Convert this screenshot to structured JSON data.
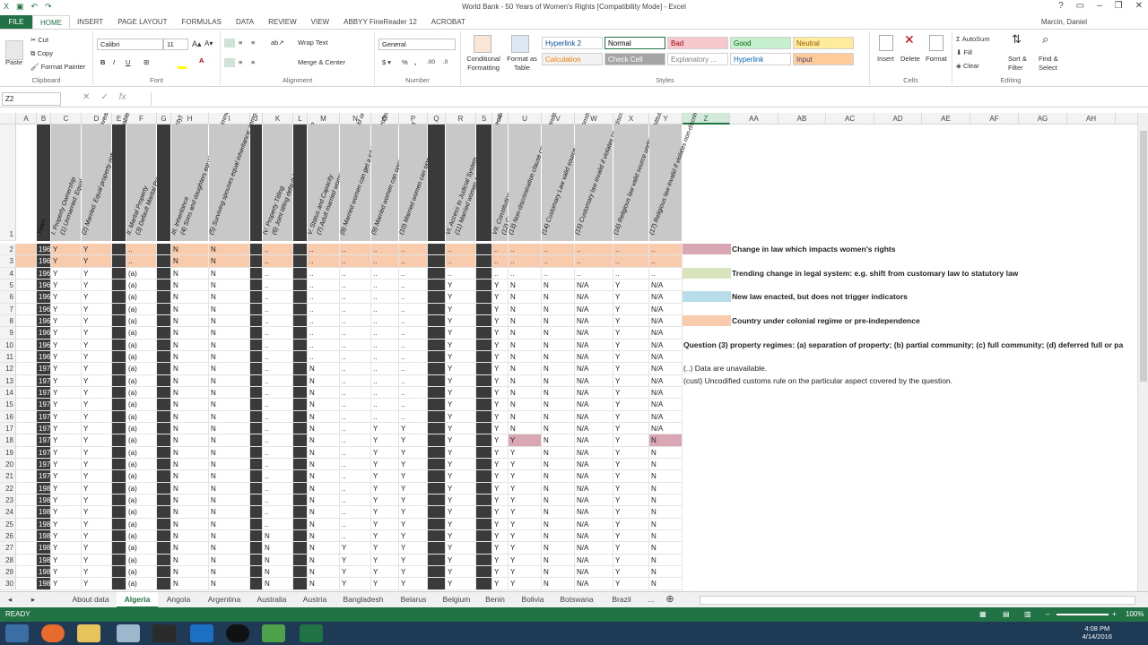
{
  "window": {
    "title": "World Bank - 50 Years of Women's Rights  [Compatibility Mode] - Excel"
  },
  "ribbon_tabs": [
    "FILE",
    "HOME",
    "INSERT",
    "PAGE LAYOUT",
    "FORMULAS",
    "DATA",
    "REVIEW",
    "VIEW",
    "ABBYY FineReader 12",
    "ACROBAT"
  ],
  "user": "Marcin, Daniel",
  "ribbon": {
    "clipboard": {
      "paste": "Paste",
      "cut": "Cut",
      "copy": "Copy",
      "format_painter": "Format Painter",
      "group": "Clipboard"
    },
    "font": {
      "name": "Calibri",
      "size": "11",
      "group": "Font"
    },
    "alignment": {
      "wrap": "Wrap Text",
      "merge": "Merge & Center",
      "group": "Alignment"
    },
    "number": {
      "format": "General",
      "group": "Number"
    },
    "styles": {
      "cond": "Conditional Formatting",
      "fmt_table": "Format as Table",
      "group": "Styles",
      "cells": [
        {
          "label": "Hyperlink 2",
          "bg": "#ffffff",
          "fg": "#0b4fa3"
        },
        {
          "label": "Normal",
          "bg": "#ffffff",
          "fg": "#000000"
        },
        {
          "label": "Bad",
          "bg": "#f7c7ce",
          "fg": "#9c0006"
        },
        {
          "label": "Good",
          "bg": "#c6efce",
          "fg": "#006100"
        },
        {
          "label": "Neutral",
          "bg": "#ffeb9c",
          "fg": "#9c5700"
        },
        {
          "label": "Calculation",
          "bg": "#f2f2f2",
          "fg": "#fa7d00"
        },
        {
          "label": "Check Cell",
          "bg": "#a5a5a5",
          "fg": "#ffffff"
        },
        {
          "label": "Explanatory ...",
          "bg": "#ffffff",
          "fg": "#7f7f7f"
        },
        {
          "label": "Hyperlink",
          "bg": "#ffffff",
          "fg": "#0563c1"
        },
        {
          "label": "Input",
          "bg": "#ffcc99",
          "fg": "#3f3f76"
        }
      ]
    },
    "cells": {
      "insert": "Insert",
      "delete": "Delete",
      "format": "Format",
      "group": "Cells"
    },
    "editing": {
      "autosum": "AutoSum",
      "fill": "Fill",
      "clear": "Clear",
      "sort": "Sort & Filter",
      "find": "Find & Select",
      "group": "Editing"
    }
  },
  "formula_bar": {
    "name_box": "Z2",
    "formula": ""
  },
  "columns": [
    "A",
    "B",
    "C",
    "D",
    "E",
    "F",
    "G",
    "H",
    "I",
    "J",
    "K",
    "L",
    "M",
    "N",
    "O",
    "P",
    "Q",
    "R",
    "S",
    "T",
    "U",
    "V",
    "W",
    "X",
    "Y",
    "Z",
    "AA",
    "AB",
    "AC",
    "AD",
    "AE",
    "AF",
    "AG",
    "AH"
  ],
  "headers": [
    "Years",
    "I. Property Ownership",
    "(1) Unmarried: Equal property rights, immoveables",
    "(2) Married: Equal property rights, immoveables",
    "II. Marital Property",
    "(3) Default Marital Property Regime (majority)",
    "III. Inheritance",
    "(4) Sons and daughters equal inheritance immoveable property (majority)",
    "(5) Surviving spouses equal inheritance: immoveable property (majority)",
    "IV. Property Titling",
    "(6) Joint titling default for married couples?",
    "V. Status and Capacity",
    "(7) Adult married women head of household or head of family",
    "(8) Married women can get a job/pursue profession",
    "(9) Married women can open bank account",
    "(10) Married women can sign contract",
    "VI. Access to Judicial System",
    "(11) Married women can initiate legal proceedings without husband's permission",
    "VII. Constitutions",
    "(12) Guaranteed Equality",
    "(13) Non-discrimination clause covering gender/sex",
    "(14) Customary Law valid source under Constitution?",
    "(15) Customary law invalid if violates non-discrimination clause",
    "(16) Religious law valid source under Constitution?",
    "(17) Religious law invalid if violates non-discrimination clause"
  ],
  "rows": [
    {
      "n": "2",
      "year": "1960",
      "c": "Y",
      "d": "Y",
      "f": "..",
      "h": "N",
      "i": "N",
      "k": "..",
      "m": "..",
      "n2": "..",
      "o": "..",
      "p": "..",
      "r": "..",
      "t": "..",
      "u": "..",
      "v": "..",
      "w": "..",
      "x": "..",
      "y": "..",
      "row_style": "colonial"
    },
    {
      "n": "3",
      "year": "1961",
      "c": "Y",
      "d": "Y",
      "f": "..",
      "h": "N",
      "i": "N",
      "k": "..",
      "m": "..",
      "n2": "..",
      "o": "..",
      "p": "..",
      "r": "..",
      "t": "..",
      "u": "..",
      "v": "..",
      "w": "..",
      "x": "..",
      "y": "..",
      "row_style": "colonial"
    },
    {
      "n": "4",
      "year": "1962",
      "c": "Y",
      "d": "Y",
      "f": "(a)",
      "h": "N",
      "i": "N",
      "k": "..",
      "m": "..",
      "n2": "..",
      "o": "..",
      "p": "..",
      "r": "..",
      "t": "..",
      "u": "..",
      "v": "..",
      "w": "..",
      "x": "..",
      "y": ".."
    },
    {
      "n": "5",
      "year": "1963",
      "c": "Y",
      "d": "Y",
      "f": "(a)",
      "h": "N",
      "i": "N",
      "k": "..",
      "m": "..",
      "n2": "..",
      "o": "..",
      "p": "..",
      "r": "Y",
      "t": "Y",
      "u": "N",
      "v": "N",
      "w": "N/A",
      "x": "Y",
      "y": "N/A"
    },
    {
      "n": "6",
      "year": "1964",
      "c": "Y",
      "d": "Y",
      "f": "(a)",
      "h": "N",
      "i": "N",
      "k": "..",
      "m": "..",
      "n2": "..",
      "o": "..",
      "p": "..",
      "r": "Y",
      "t": "Y",
      "u": "N",
      "v": "N",
      "w": "N/A",
      "x": "Y",
      "y": "N/A"
    },
    {
      "n": "7",
      "year": "1965",
      "c": "Y",
      "d": "Y",
      "f": "(a)",
      "h": "N",
      "i": "N",
      "k": "..",
      "m": "..",
      "n2": "..",
      "o": "..",
      "p": "..",
      "r": "Y",
      "t": "Y",
      "u": "N",
      "v": "N",
      "w": "N/A",
      "x": "Y",
      "y": "N/A"
    },
    {
      "n": "8",
      "year": "1966",
      "c": "Y",
      "d": "Y",
      "f": "(a)",
      "h": "N",
      "i": "N",
      "k": "..",
      "m": "..",
      "n2": "..",
      "o": "..",
      "p": "..",
      "r": "Y",
      "t": "Y",
      "u": "N",
      "v": "N",
      "w": "N/A",
      "x": "Y",
      "y": "N/A"
    },
    {
      "n": "9",
      "year": "1967",
      "c": "Y",
      "d": "Y",
      "f": "(a)",
      "h": "N",
      "i": "N",
      "k": "..",
      "m": "..",
      "n2": "..",
      "o": "..",
      "p": "..",
      "r": "Y",
      "t": "Y",
      "u": "N",
      "v": "N",
      "w": "N/A",
      "x": "Y",
      "y": "N/A"
    },
    {
      "n": "10",
      "year": "1968",
      "c": "Y",
      "d": "Y",
      "f": "(a)",
      "h": "N",
      "i": "N",
      "k": "..",
      "m": "..",
      "n2": "..",
      "o": "..",
      "p": "..",
      "r": "Y",
      "t": "Y",
      "u": "N",
      "v": "N",
      "w": "N/A",
      "x": "Y",
      "y": "N/A"
    },
    {
      "n": "11",
      "year": "1969",
      "c": "Y",
      "d": "Y",
      "f": "(a)",
      "h": "N",
      "i": "N",
      "k": "..",
      "m": "..",
      "n2": "..",
      "o": "..",
      "p": "..",
      "r": "Y",
      "t": "Y",
      "u": "N",
      "v": "N",
      "w": "N/A",
      "x": "Y",
      "y": "N/A"
    },
    {
      "n": "12",
      "year": "1970",
      "c": "Y",
      "d": "Y",
      "f": "(a)",
      "h": "N",
      "i": "N",
      "k": "..",
      "m": "N",
      "n2": "..",
      "o": "..",
      "p": "..",
      "r": "Y",
      "t": "Y",
      "u": "N",
      "v": "N",
      "w": "N/A",
      "x": "Y",
      "y": "N/A"
    },
    {
      "n": "13",
      "year": "1971",
      "c": "Y",
      "d": "Y",
      "f": "(a)",
      "h": "N",
      "i": "N",
      "k": "..",
      "m": "N",
      "n2": "..",
      "o": "..",
      "p": "..",
      "r": "Y",
      "t": "Y",
      "u": "N",
      "v": "N",
      "w": "N/A",
      "x": "Y",
      "y": "N/A"
    },
    {
      "n": "14",
      "year": "1972",
      "c": "Y",
      "d": "Y",
      "f": "(a)",
      "h": "N",
      "i": "N",
      "k": "..",
      "m": "N",
      "n2": "..",
      "o": "..",
      "p": "..",
      "r": "Y",
      "t": "Y",
      "u": "N",
      "v": "N",
      "w": "N/A",
      "x": "Y",
      "y": "N/A"
    },
    {
      "n": "15",
      "year": "1973",
      "c": "Y",
      "d": "Y",
      "f": "(a)",
      "h": "N",
      "i": "N",
      "k": "..",
      "m": "N",
      "n2": "..",
      "o": "..",
      "p": "..",
      "r": "Y",
      "t": "Y",
      "u": "N",
      "v": "N",
      "w": "N/A",
      "x": "Y",
      "y": "N/A"
    },
    {
      "n": "16",
      "year": "1974",
      "c": "Y",
      "d": "Y",
      "f": "(a)",
      "h": "N",
      "i": "N",
      "k": "..",
      "m": "N",
      "n2": "..",
      "o": "..",
      "p": "..",
      "r": "Y",
      "t": "Y",
      "u": "N",
      "v": "N",
      "w": "N/A",
      "x": "Y",
      "y": "N/A"
    },
    {
      "n": "17",
      "year": "1975",
      "c": "Y",
      "d": "Y",
      "f": "(a)",
      "h": "N",
      "i": "N",
      "k": "..",
      "m": "N",
      "n2": "..",
      "o": "Y",
      "p": "Y",
      "r": "Y",
      "t": "Y",
      "u": "N",
      "v": "N",
      "w": "N/A",
      "x": "Y",
      "y": "N/A"
    },
    {
      "n": "18",
      "year": "1976",
      "c": "Y",
      "d": "Y",
      "f": "(a)",
      "h": "N",
      "i": "N",
      "k": "..",
      "m": "N",
      "n2": "..",
      "o": "Y",
      "p": "Y",
      "r": "Y",
      "t": "Y",
      "u": "Y",
      "v": "N",
      "w": "N/A",
      "x": "Y",
      "y": "N",
      "change": true
    },
    {
      "n": "19",
      "year": "1977",
      "c": "Y",
      "d": "Y",
      "f": "(a)",
      "h": "N",
      "i": "N",
      "k": "..",
      "m": "N",
      "n2": "..",
      "o": "Y",
      "p": "Y",
      "r": "Y",
      "t": "Y",
      "u": "Y",
      "v": "N",
      "w": "N/A",
      "x": "Y",
      "y": "N"
    },
    {
      "n": "20",
      "year": "1978",
      "c": "Y",
      "d": "Y",
      "f": "(a)",
      "h": "N",
      "i": "N",
      "k": "..",
      "m": "N",
      "n2": "..",
      "o": "Y",
      "p": "Y",
      "r": "Y",
      "t": "Y",
      "u": "Y",
      "v": "N",
      "w": "N/A",
      "x": "Y",
      "y": "N"
    },
    {
      "n": "21",
      "year": "1979",
      "c": "Y",
      "d": "Y",
      "f": "(a)",
      "h": "N",
      "i": "N",
      "k": "..",
      "m": "N",
      "n2": "..",
      "o": "Y",
      "p": "Y",
      "r": "Y",
      "t": "Y",
      "u": "Y",
      "v": "N",
      "w": "N/A",
      "x": "Y",
      "y": "N"
    },
    {
      "n": "22",
      "year": "1980",
      "c": "Y",
      "d": "Y",
      "f": "(a)",
      "h": "N",
      "i": "N",
      "k": "..",
      "m": "N",
      "n2": "..",
      "o": "Y",
      "p": "Y",
      "r": "Y",
      "t": "Y",
      "u": "Y",
      "v": "N",
      "w": "N/A",
      "x": "Y",
      "y": "N"
    },
    {
      "n": "23",
      "year": "1981",
      "c": "Y",
      "d": "Y",
      "f": "(a)",
      "h": "N",
      "i": "N",
      "k": "..",
      "m": "N",
      "n2": "..",
      "o": "Y",
      "p": "Y",
      "r": "Y",
      "t": "Y",
      "u": "Y",
      "v": "N",
      "w": "N/A",
      "x": "Y",
      "y": "N"
    },
    {
      "n": "24",
      "year": "1982",
      "c": "Y",
      "d": "Y",
      "f": "(a)",
      "h": "N",
      "i": "N",
      "k": "..",
      "m": "N",
      "n2": "..",
      "o": "Y",
      "p": "Y",
      "r": "Y",
      "t": "Y",
      "u": "Y",
      "v": "N",
      "w": "N/A",
      "x": "Y",
      "y": "N"
    },
    {
      "n": "25",
      "year": "1983",
      "c": "Y",
      "d": "Y",
      "f": "(a)",
      "h": "N",
      "i": "N",
      "k": "..",
      "m": "N",
      "n2": "..",
      "o": "Y",
      "p": "Y",
      "r": "Y",
      "t": "Y",
      "u": "Y",
      "v": "N",
      "w": "N/A",
      "x": "Y",
      "y": "N"
    },
    {
      "n": "26",
      "year": "1984",
      "c": "Y",
      "d": "Y",
      "f": "(a)",
      "h": "N",
      "i": "N",
      "k": "N",
      "m": "N",
      "n2": "..",
      "o": "Y",
      "p": "Y",
      "r": "Y",
      "t": "Y",
      "u": "Y",
      "v": "N",
      "w": "N/A",
      "x": "Y",
      "y": "N"
    },
    {
      "n": "27",
      "year": "1985",
      "c": "Y",
      "d": "Y",
      "f": "(a)",
      "h": "N",
      "i": "N",
      "k": "N",
      "m": "N",
      "n2": "Y",
      "o": "Y",
      "p": "Y",
      "r": "Y",
      "t": "Y",
      "u": "Y",
      "v": "N",
      "w": "N/A",
      "x": "Y",
      "y": "N"
    },
    {
      "n": "28",
      "year": "1986",
      "c": "Y",
      "d": "Y",
      "f": "(a)",
      "h": "N",
      "i": "N",
      "k": "N",
      "m": "N",
      "n2": "Y",
      "o": "Y",
      "p": "Y",
      "r": "Y",
      "t": "Y",
      "u": "Y",
      "v": "N",
      "w": "N/A",
      "x": "Y",
      "y": "N"
    },
    {
      "n": "29",
      "year": "1987",
      "c": "Y",
      "d": "Y",
      "f": "(a)",
      "h": "N",
      "i": "N",
      "k": "N",
      "m": "N",
      "n2": "Y",
      "o": "Y",
      "p": "Y",
      "r": "Y",
      "t": "Y",
      "u": "Y",
      "v": "N",
      "w": "N/A",
      "x": "Y",
      "y": "N"
    },
    {
      "n": "30",
      "year": "1988",
      "c": "Y",
      "d": "Y",
      "f": "(a)",
      "h": "N",
      "i": "N",
      "k": "N",
      "m": "N",
      "n2": "Y",
      "o": "Y",
      "p": "Y",
      "r": "Y",
      "t": "Y",
      "u": "Y",
      "v": "N",
      "w": "N/A",
      "x": "Y",
      "y": "N"
    }
  ],
  "legend": [
    {
      "color": "#d9a6b4",
      "text": "Change in law which impacts women's rights"
    },
    {
      "color": "#d7e4bd",
      "text": "Trending change in legal system: e.g. shift from customary law to statutory law"
    },
    {
      "color": "#b7dde8",
      "text": "New law enacted, but does not trigger indicators"
    },
    {
      "color": "#f8cbad",
      "text": "Country under colonial regime or pre-independence"
    }
  ],
  "notes": {
    "question3": "Question (3) property regimes: (a) separation of property; (b) partial community; (c) full community; (d) deferred full or pa",
    "unavailable": "(..) Data are unavailable.",
    "cust": "(cust) Uncodified customs rule on the particular aspect covered by the question."
  },
  "sheet_tabs": [
    "About data",
    "Algeria",
    "Angola",
    "Argentina",
    "Australia",
    "Austria",
    "Bangladesh",
    "Belarus",
    "Belgium",
    "Benin",
    "Bolivia",
    "Botswana",
    "Brazil",
    "..."
  ],
  "active_sheet": "Algeria",
  "status": {
    "mode": "READY",
    "zoom": "100%"
  },
  "clock": {
    "time": "4:08 PM",
    "date": "4/14/2016"
  },
  "colors": {
    "accent": "#217346",
    "colonial": "#f8cbad",
    "change": "#d9a6b4"
  }
}
